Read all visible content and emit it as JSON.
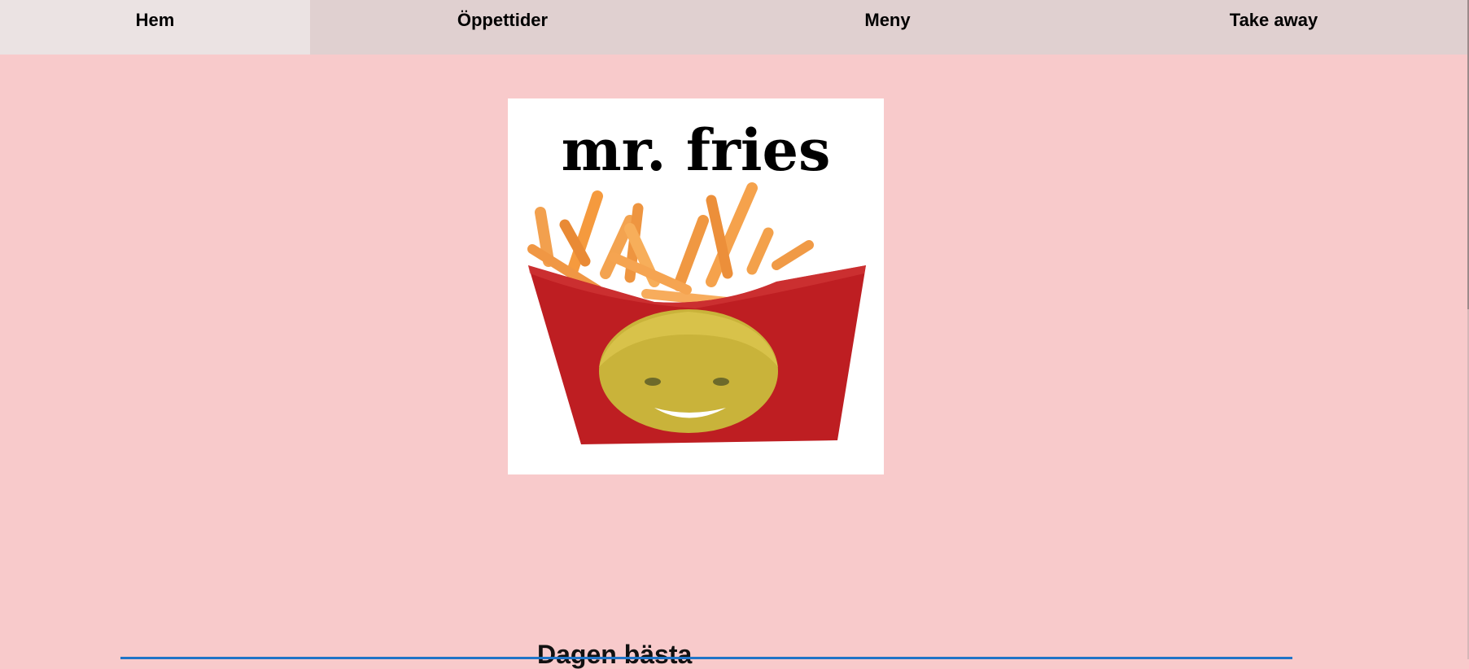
{
  "nav": {
    "items": [
      {
        "label": "Hem",
        "active": true
      },
      {
        "label": "Öppettider",
        "active": false
      },
      {
        "label": "Meny",
        "active": false
      },
      {
        "label": "Take away",
        "active": false
      }
    ]
  },
  "logo": {
    "text": "mr. fries",
    "icon": "fries-box-logo-image"
  },
  "section": {
    "heading": "Dagen bästa"
  },
  "colors": {
    "page_background": "#f8cacb",
    "nav_background": "#e0d0d0",
    "nav_active_background": "#ebe3e3",
    "divider": "#1f74c8"
  }
}
